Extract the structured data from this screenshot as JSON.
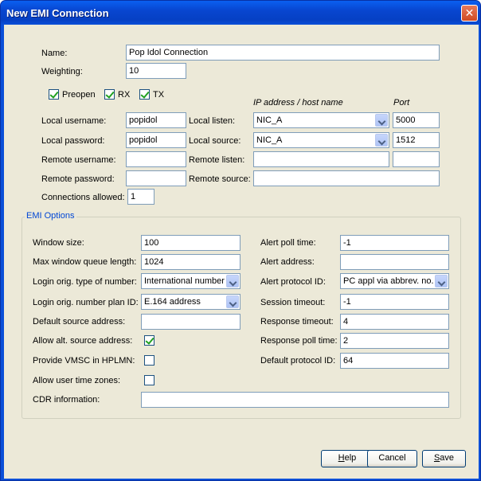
{
  "window": {
    "title": "New EMI Connection",
    "close_glyph": "✕"
  },
  "connection": {
    "name_label": "Name:",
    "name_value": "Pop Idol Connection",
    "weighting_label": "Weighting:",
    "weighting_value": "10",
    "preopen_label": "Preopen",
    "preopen_checked": true,
    "rx_label": "RX",
    "rx_checked": true,
    "tx_label": "TX",
    "tx_checked": true,
    "ip_header": "IP address / host name",
    "port_header": "Port",
    "local_username_label": "Local username:",
    "local_username_value": "popidol",
    "local_password_label": "Local password:",
    "local_password_value": "popidol",
    "remote_username_label": "Remote username:",
    "remote_username_value": "",
    "remote_password_label": "Remote password:",
    "remote_password_value": "",
    "connections_allowed_label": "Connections allowed:",
    "connections_allowed_value": "1",
    "local_listen_label": "Local listen:",
    "local_listen_value": "NIC_A",
    "local_listen_port": "5000",
    "local_source_label": "Local source:",
    "local_source_value": "NIC_A",
    "local_source_port": "1512",
    "remote_listen_label": "Remote listen:",
    "remote_listen_value": "",
    "remote_listen_port": "",
    "remote_source_label": "Remote source:",
    "remote_source_value": ""
  },
  "emi": {
    "legend": "EMI Options",
    "window_size_label": "Window size:",
    "window_size_value": "100",
    "max_queue_label": "Max window queue length:",
    "max_queue_value": "1024",
    "login_ton_label": "Login orig. type of number:",
    "login_ton_value": "International number",
    "login_npi_label": "Login orig. number plan ID:",
    "login_npi_value": "E.164 address",
    "default_source_label": "Default source address:",
    "default_source_value": "",
    "allow_alt_label": "Allow alt. source address:",
    "allow_alt_checked": true,
    "provide_vmsc_label": "Provide VMSC in HPLMN:",
    "provide_vmsc_checked": false,
    "allow_tz_label": "Allow user time zones:",
    "allow_tz_checked": false,
    "cdr_label": "CDR information:",
    "cdr_value": "",
    "alert_poll_label": "Alert poll time:",
    "alert_poll_value": "-1",
    "alert_address_label": "Alert address:",
    "alert_address_value": "",
    "alert_protocol_label": "Alert protocol ID:",
    "alert_protocol_value": "PC appl via abbrev. no.",
    "session_timeout_label": "Session timeout:",
    "session_timeout_value": "-1",
    "response_timeout_label": "Response timeout:",
    "response_timeout_value": "4",
    "response_poll_label": "Response poll time:",
    "response_poll_value": "2",
    "default_protocol_label": "Default protocol ID:",
    "default_protocol_value": "64"
  },
  "buttons": {
    "help_label": "Help",
    "help_mnemonic": "H",
    "cancel_label": "Cancel",
    "save_label": "Save",
    "save_mnemonic": "S"
  }
}
